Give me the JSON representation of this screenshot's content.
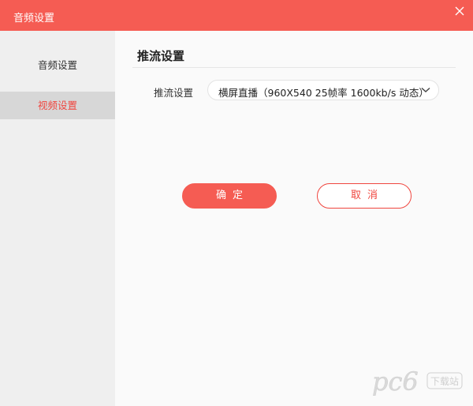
{
  "window": {
    "title": "音频设置",
    "close_icon": "close-icon"
  },
  "sidebar": {
    "items": [
      {
        "label": "音频设置",
        "selected": false
      },
      {
        "label": "视频设置",
        "selected": true
      }
    ]
  },
  "main": {
    "section_title": "推流设置",
    "stream_setting": {
      "label": "推流设置",
      "selected_value": "横屏直播（960X540  25帧率  1600kb/s 动态）"
    },
    "buttons": {
      "ok_label": "确定",
      "cancel_label": "取消"
    }
  },
  "watermark": {
    "brand": "pc6",
    "text": "下载站"
  },
  "colors": {
    "accent": "#f55c53",
    "accent_text": "#f0463f",
    "sidebar_bg": "#efefef",
    "sidebar_selected_bg": "#d7d7d7"
  }
}
